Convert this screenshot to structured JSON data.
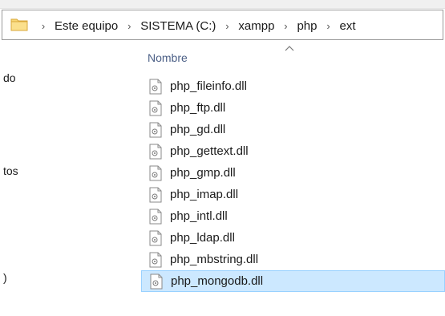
{
  "breadcrumb": {
    "items": [
      "Este equipo",
      "SISTEMA (C:)",
      "xampp",
      "php",
      "ext"
    ]
  },
  "nav_pane": {
    "labels": [
      "do",
      "tos",
      ")"
    ]
  },
  "columns": {
    "name_header": "Nombre",
    "sort": "ascending"
  },
  "files": [
    {
      "name": "php_fileinfo.dll"
    },
    {
      "name": "php_ftp.dll"
    },
    {
      "name": "php_gd.dll"
    },
    {
      "name": "php_gettext.dll"
    },
    {
      "name": "php_gmp.dll"
    },
    {
      "name": "php_imap.dll"
    },
    {
      "name": "php_intl.dll"
    },
    {
      "name": "php_ldap.dll"
    },
    {
      "name": "php_mbstring.dll"
    },
    {
      "name": "php_mongodb.dll"
    }
  ],
  "selected_file": "php_mongodb.dll",
  "colors": {
    "folder": "#f8d775",
    "selection_bg": "#cce8ff",
    "selection_border": "#99d1ff",
    "header_text": "#4b5f86"
  },
  "icons": {
    "location": "folder-icon",
    "separator": "chevron-right-icon",
    "sort": "sort-ascending-icon",
    "file": "dll-file-icon"
  }
}
